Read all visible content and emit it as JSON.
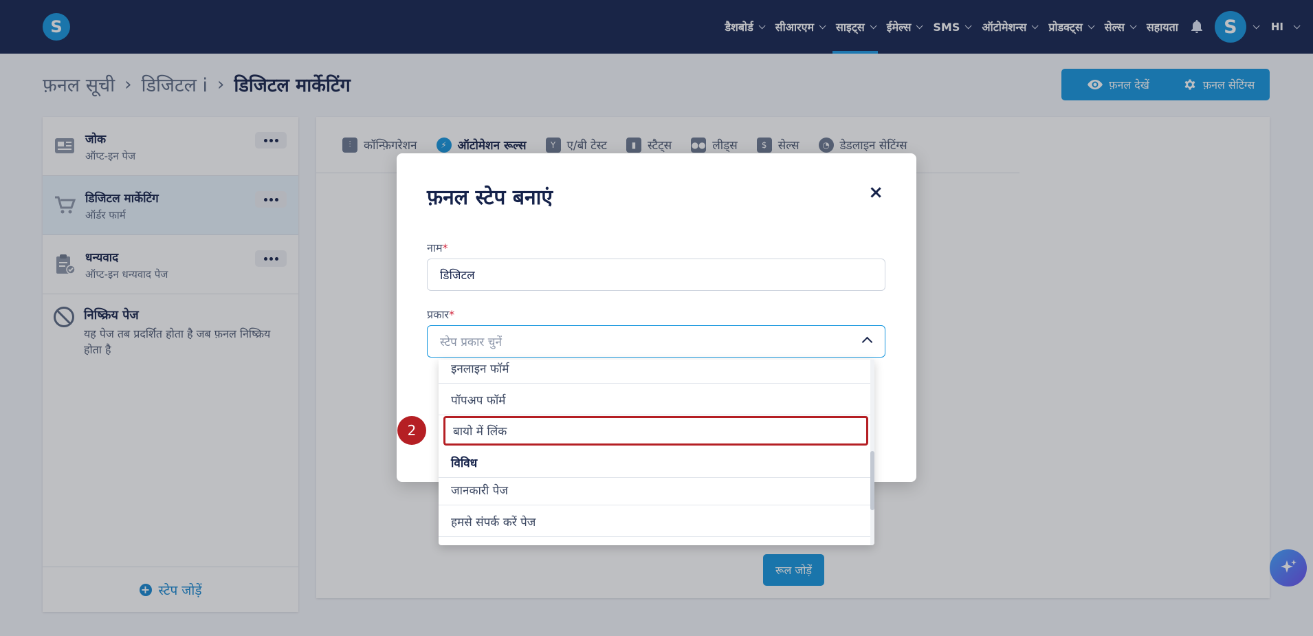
{
  "app": {
    "logo_letter": "S"
  },
  "nav": {
    "items": [
      {
        "label": "डैशबोर्ड",
        "active": false
      },
      {
        "label": "सीआरएम",
        "active": false
      },
      {
        "label": "साइट्स",
        "active": true
      },
      {
        "label": "ईमेल्स",
        "active": false
      },
      {
        "label": "SMS",
        "active": false
      },
      {
        "label": "ऑटोमेशन्स",
        "active": false
      },
      {
        "label": "प्रोडक्ट्स",
        "active": false
      },
      {
        "label": "सेल्स",
        "active": false
      }
    ],
    "help_label": "सहायता",
    "avatar_letter": "S",
    "language": "HI"
  },
  "breadcrumb": {
    "items": [
      "फ़नल सूची",
      "डिजिटल i"
    ],
    "current": "डिजिटल मार्केटिंग"
  },
  "header_buttons": {
    "view_funnel": "फ़नल देखें",
    "funnel_settings": "फ़नल सेटिंग्स"
  },
  "sidebar": {
    "steps": [
      {
        "title": "जोक",
        "subtitle": "ऑप्ट-इन पेज",
        "icon": "optin-page-icon",
        "selected": false
      },
      {
        "title": "डिजिटल मार्केटिंग",
        "subtitle": "ऑर्डर फार्म",
        "icon": "cart-icon",
        "selected": true
      },
      {
        "title": "धन्यवाद",
        "subtitle": "ऑप्ट-इन धन्यवाद पेज",
        "icon": "clipboard-check-icon",
        "selected": false
      }
    ],
    "inactive": {
      "title": "निष्क्रिय पेज",
      "description": "यह पेज तब प्रदर्शित होता है जब फ़नल निष्क्रिय होता है"
    },
    "add_step_label": "स्टेप जोड़ें"
  },
  "tabs": [
    {
      "label": "कॉन्फ़िगरेशन",
      "icon": "sliders-icon",
      "active": false
    },
    {
      "label": "ऑटोमेशन रूल्स",
      "icon": "bolt-icon",
      "active": true
    },
    {
      "label": "ए/बी टेस्ट",
      "icon": "split-icon",
      "active": false
    },
    {
      "label": "स्टैट्स",
      "icon": "bar-chart-icon",
      "active": false
    },
    {
      "label": "लीड्स",
      "icon": "users-icon",
      "active": false
    },
    {
      "label": "सेल्स",
      "icon": "dollar-icon",
      "active": false
    },
    {
      "label": "डेडलाइन सेटिंग्स",
      "icon": "clock-icon",
      "active": false
    }
  ],
  "main": {
    "add_rule_label": "रूल जोड़ें"
  },
  "modal": {
    "title": "फ़नल स्टेप बनाएं",
    "close_symbol": "×",
    "name_label": "नाम",
    "name_value": "डिजिटल",
    "type_label": "प्रकार",
    "type_placeholder": "स्टेप प्रकार चुनें",
    "required_mark": "*",
    "options": [
      {
        "label": "इनलाइन फॉर्म",
        "kind": "option"
      },
      {
        "label": "पॉपअप फॉर्म",
        "kind": "option"
      },
      {
        "label": "बायो में लिंक",
        "kind": "option",
        "highlighted": true
      },
      {
        "label": "विविध",
        "kind": "group"
      },
      {
        "label": "जानकारी पेज",
        "kind": "option"
      },
      {
        "label": "हमसे संपर्क करें पेज",
        "kind": "option"
      }
    ]
  },
  "annotation": {
    "step_number": "2"
  },
  "colors": {
    "nav_bg": "#14234f",
    "primary": "#1596de",
    "highlight_red": "#b51f24"
  }
}
